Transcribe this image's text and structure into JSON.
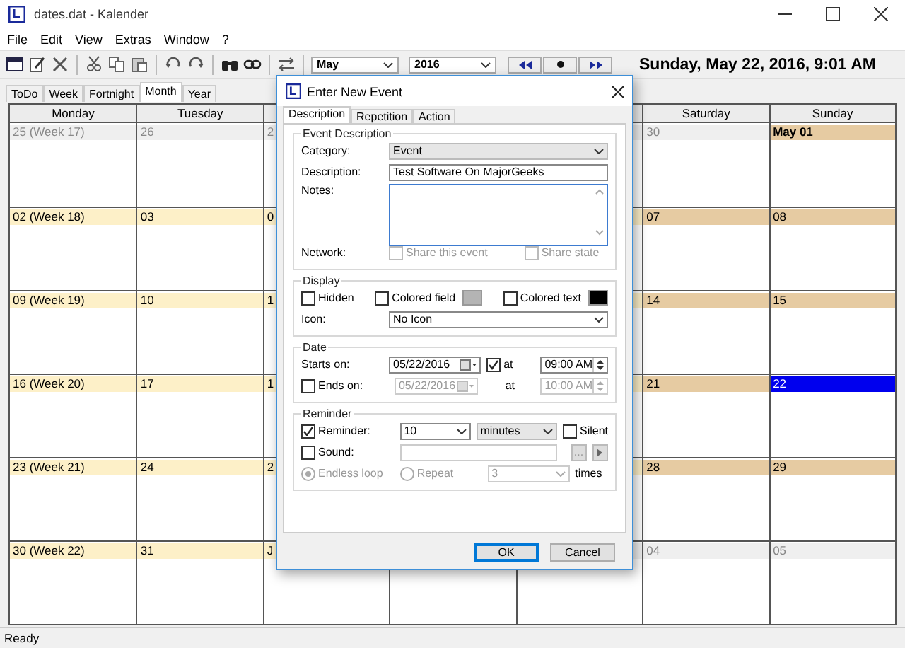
{
  "window": {
    "title": "dates.dat - Kalender"
  },
  "menu": [
    "File",
    "Edit",
    "View",
    "Extras",
    "Window",
    "?"
  ],
  "toolbar": {
    "month": "May",
    "year": "2016",
    "datetime": "Sunday, May 22, 2016, 9:01 AM"
  },
  "view_tabs": [
    {
      "label": "ToDo",
      "selected": false
    },
    {
      "label": "Week",
      "selected": false
    },
    {
      "label": "Fortnight",
      "selected": false
    },
    {
      "label": "Month",
      "selected": true
    },
    {
      "label": "Year",
      "selected": false
    }
  ],
  "calendar": {
    "headers_left": [
      "Monday",
      "Tuesday"
    ],
    "headers_right": [
      "Saturday",
      "Sunday"
    ],
    "weeks": [
      [
        {
          "date": "25 (Week 17)",
          "kind": "other"
        },
        {
          "date": "26",
          "kind": "other"
        },
        {
          "date": "2",
          "kind": "other"
        },
        {
          "kind": "other"
        },
        {
          "kind": "other"
        },
        {
          "date": "30",
          "kind": "other"
        },
        {
          "date": "May 01",
          "kind": "first"
        }
      ],
      [
        {
          "date": "02 (Week 18)",
          "kind": "weekday"
        },
        {
          "date": "03",
          "kind": "weekday"
        },
        {
          "date": "0",
          "kind": "weekday"
        },
        {
          "kind": "weekday"
        },
        {
          "kind": "weekday"
        },
        {
          "date": "07",
          "kind": "weekend"
        },
        {
          "date": "08",
          "kind": "weekend"
        }
      ],
      [
        {
          "date": "09 (Week 19)",
          "kind": "weekday"
        },
        {
          "date": "10",
          "kind": "weekday"
        },
        {
          "date": "1",
          "kind": "weekday"
        },
        {
          "kind": "weekday"
        },
        {
          "kind": "weekday"
        },
        {
          "date": "14",
          "kind": "weekend"
        },
        {
          "date": "15",
          "kind": "weekend"
        }
      ],
      [
        {
          "date": "16 (Week 20)",
          "kind": "weekday"
        },
        {
          "date": "17",
          "kind": "weekday"
        },
        {
          "date": "1",
          "kind": "weekday"
        },
        {
          "kind": "weekday"
        },
        {
          "kind": "weekday"
        },
        {
          "date": "21",
          "kind": "weekend"
        },
        {
          "date": "22",
          "kind": "today"
        }
      ],
      [
        {
          "date": "23 (Week 21)",
          "kind": "weekday"
        },
        {
          "date": "24",
          "kind": "weekday"
        },
        {
          "date": "2",
          "kind": "weekday"
        },
        {
          "kind": "weekday"
        },
        {
          "kind": "weekday"
        },
        {
          "date": "28",
          "kind": "weekend"
        },
        {
          "date": "29",
          "kind": "weekend"
        }
      ],
      [
        {
          "date": "30 (Week 22)",
          "kind": "weekday"
        },
        {
          "date": "31",
          "kind": "weekday"
        },
        {
          "date": "J",
          "kind": "weekday"
        },
        {
          "kind": "other"
        },
        {
          "kind": "other"
        },
        {
          "date": "04",
          "kind": "other"
        },
        {
          "date": "05",
          "kind": "other"
        }
      ]
    ]
  },
  "dialog": {
    "title": "Enter New Event",
    "tabs": [
      {
        "label": "Description",
        "selected": true
      },
      {
        "label": "Repetition",
        "selected": false
      },
      {
        "label": "Action",
        "selected": false
      }
    ],
    "event_description": {
      "title": "Event Description",
      "category_label": "Category:",
      "category": "Event",
      "description_label": "Description:",
      "description": "Test Software On MajorGeeks",
      "notes_label": "Notes:",
      "network_label": "Network:",
      "share_event": {
        "label": "Share this event",
        "checked": false,
        "disabled": true
      },
      "share_state": {
        "label": "Share state",
        "checked": false,
        "disabled": true
      }
    },
    "display": {
      "title": "Display",
      "hidden": {
        "label": "Hidden",
        "checked": false
      },
      "colored_field": {
        "label": "Colored field",
        "checked": false,
        "color": "#b4b4b4"
      },
      "colored_text": {
        "label": "Colored text",
        "checked": false,
        "color": "#000000"
      },
      "icon_label": "Icon:",
      "icon": "No Icon"
    },
    "date": {
      "title": "Date",
      "starts_label": "Starts on:",
      "starts_date": "05/22/2016",
      "start_at": {
        "label": "at",
        "checked": true
      },
      "start_time": "09:00 AM",
      "ends": {
        "label": "Ends on:",
        "checked": false
      },
      "ends_date": "05/22/2016",
      "end_at_label": "at",
      "end_time": "10:00 AM"
    },
    "reminder": {
      "title": "Reminder",
      "reminder": {
        "label": "Reminder:",
        "checked": true
      },
      "amount": "10",
      "unit": "minutes",
      "silent": {
        "label": "Silent",
        "checked": false
      },
      "sound": {
        "label": "Sound:",
        "checked": false
      },
      "browse_label": "...",
      "loop_options": [
        {
          "label": "Endless loop",
          "selected": true
        },
        {
          "label": "Repeat",
          "selected": false
        }
      ],
      "repeat_count": "3",
      "times_label": "times"
    },
    "buttons": [
      {
        "label": "OK",
        "default": true
      },
      {
        "label": "Cancel",
        "default": false
      }
    ]
  },
  "status_bar": {
    "text": "Ready"
  }
}
